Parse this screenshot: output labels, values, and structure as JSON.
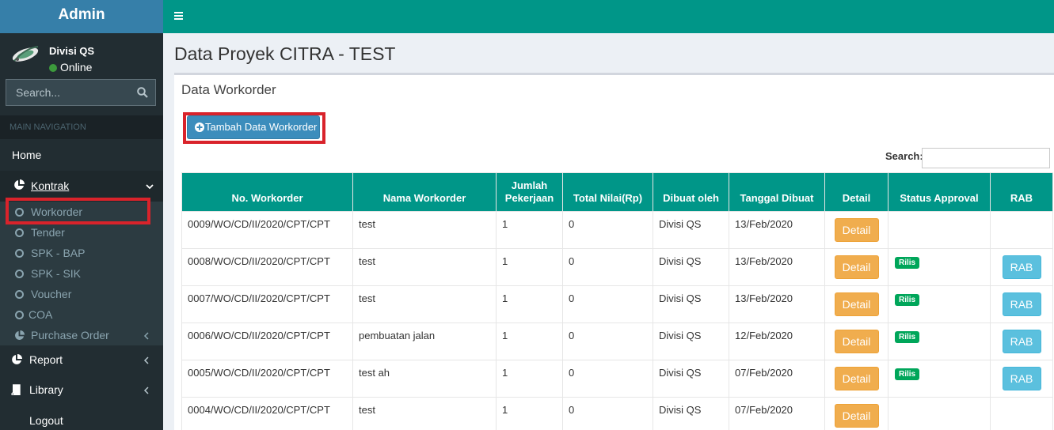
{
  "app": {
    "logo": "Admin"
  },
  "user": {
    "name": "Divisi QS",
    "status": "Online"
  },
  "sidebar": {
    "search_placeholder": "Search...",
    "nav_header": "MAIN NAVIGATION",
    "home": "Home",
    "kontrak": "Kontrak",
    "sub_items": [
      "Workorder",
      "Tender",
      "SPK - BAP",
      "SPK - SIK",
      "Voucher",
      "COA",
      "Purchase Order"
    ],
    "report": "Report",
    "library": "Library",
    "logout": "Logout"
  },
  "page": {
    "title": "Data Proyek CITRA - TEST",
    "box_title": "Data Workorder",
    "add_button": "Tambah Data Workorder",
    "search_label": "Search:"
  },
  "table": {
    "headers": [
      "No. Workorder",
      "Nama Workorder",
      "Jumlah Pekerjaan",
      "Total Nilai(Rp)",
      "Dibuat oleh",
      "Tanggal Dibuat",
      "Detail",
      "Status Approval",
      "RAB"
    ],
    "detail_label": "Detail",
    "rab_label": "RAB",
    "badge_label": "Rilis",
    "rows": [
      {
        "no": "0009/WO/CD/II/2020/CPT/CPT",
        "nama": "test",
        "jumlah": "1",
        "total": "0",
        "oleh": "Divisi QS",
        "tanggal": "13/Feb/2020",
        "status": "",
        "rab": false
      },
      {
        "no": "0008/WO/CD/II/2020/CPT/CPT",
        "nama": "test",
        "jumlah": "1",
        "total": "0",
        "oleh": "Divisi QS",
        "tanggal": "13/Feb/2020",
        "status": "Rilis",
        "rab": true
      },
      {
        "no": "0007/WO/CD/II/2020/CPT/CPT",
        "nama": "test",
        "jumlah": "1",
        "total": "0",
        "oleh": "Divisi QS",
        "tanggal": "13/Feb/2020",
        "status": "Rilis",
        "rab": true
      },
      {
        "no": "0006/WO/CD/II/2020/CPT/CPT",
        "nama": "pembuatan jalan",
        "jumlah": "1",
        "total": "0",
        "oleh": "Divisi QS",
        "tanggal": "12/Feb/2020",
        "status": "Rilis",
        "rab": true
      },
      {
        "no": "0005/WO/CD/II/2020/CPT/CPT",
        "nama": "test ah",
        "jumlah": "1",
        "total": "0",
        "oleh": "Divisi QS",
        "tanggal": "07/Feb/2020",
        "status": "Rilis",
        "rab": true
      },
      {
        "no": "0004/WO/CD/II/2020/CPT/CPT",
        "nama": "test",
        "jumlah": "1",
        "total": "0",
        "oleh": "Divisi QS",
        "tanggal": "07/Feb/2020",
        "status": "",
        "rab": false
      }
    ]
  },
  "colors": {
    "accent": "#009688",
    "logo_bg": "#367fa9",
    "sidebar_bg": "#222d32",
    "highlight": "#d9232b"
  }
}
